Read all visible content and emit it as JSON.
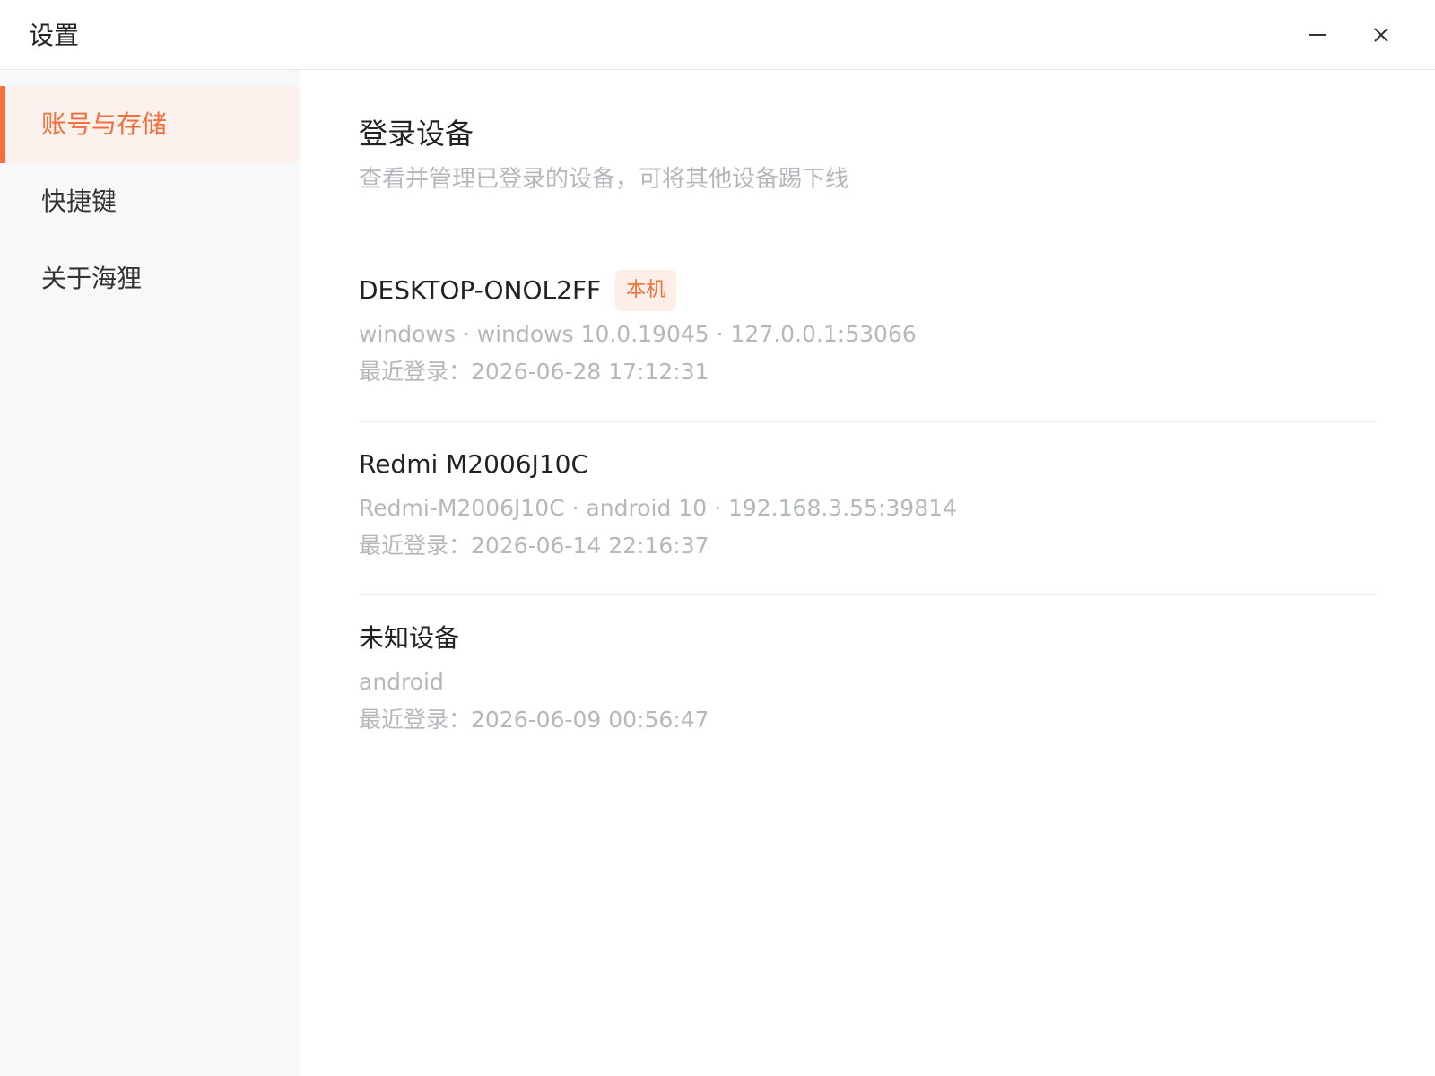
{
  "window": {
    "title": "设置",
    "minimize_icon": "minimize-icon",
    "close_icon": "close-icon"
  },
  "sidebar": {
    "items": [
      {
        "label": "账号与存储",
        "active": true
      },
      {
        "label": "快捷键",
        "active": false
      },
      {
        "label": "关于海狸",
        "active": false
      }
    ]
  },
  "main": {
    "title": "登录设备",
    "description": "查看并管理已登录的设备，可将其他设备踢下线",
    "devices": [
      {
        "name": "DESKTOP-ONOL2FF",
        "badge": "本机",
        "meta": "windows · windows 10.0.19045 · 127.0.0.1:53066",
        "last_login": "最近登录：2026-06-28 17:12:31"
      },
      {
        "name": "Redmi M2006J10C",
        "meta": "Redmi-M2006J10C · android 10 · 192.168.3.55:39814",
        "last_login": "最近登录：2026-06-14 22:16:37"
      },
      {
        "name": "未知设备",
        "meta": "android",
        "last_login": "最近登录：2026-06-09 00:56:47"
      }
    ]
  },
  "colors": {
    "accent": "#f2703c",
    "accent_bg": "#fcf1ec",
    "text_primary": "#222222",
    "text_muted": "#b4b8bd",
    "sidebar_bg": "#f7f8fa"
  }
}
